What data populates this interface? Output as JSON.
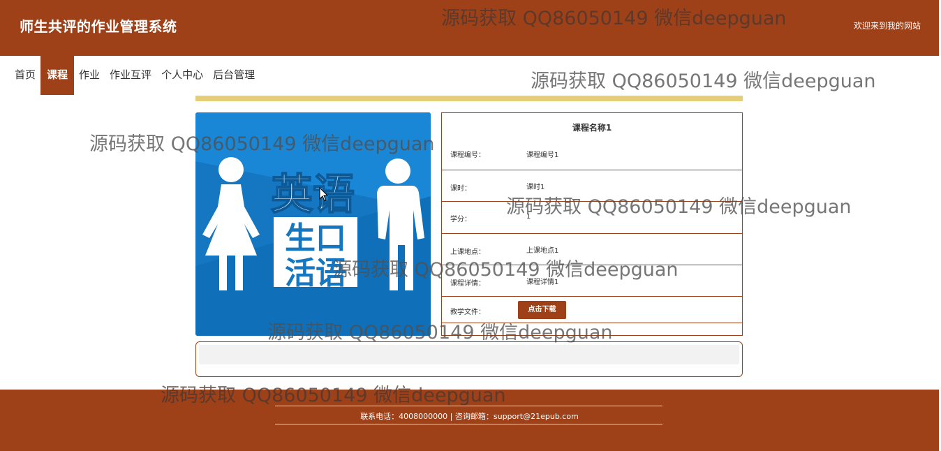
{
  "header": {
    "title": "师生共评的作业管理系统",
    "welcome": "欢迎来到我的网站"
  },
  "nav": {
    "items": [
      {
        "label": "首页"
      },
      {
        "label": "课程",
        "active": true
      },
      {
        "label": "作业"
      },
      {
        "label": "作业互评"
      },
      {
        "label": "个人中心"
      },
      {
        "label": "后台管理"
      }
    ]
  },
  "course": {
    "image_text": [
      "英语",
      "生口",
      "活语"
    ],
    "name": "课程名称1",
    "fields": [
      {
        "label": "课程编号：",
        "value": "课程编号1"
      },
      {
        "label": "课时：",
        "value": "课时1"
      },
      {
        "label": "学分：",
        "value": "1"
      },
      {
        "label": "上课地点：",
        "value": "上课地点1"
      },
      {
        "label": "课程详情：",
        "value": "课程详情1"
      }
    ],
    "file_label": "教学文件：",
    "download_label": "点击下载"
  },
  "footer": {
    "contact": "联系电话：4008000000 | 咨询邮箱：support@21epub.com"
  },
  "watermark": "源码获取 QQ86050149 微信deepguan",
  "colors": {
    "brand": "#9e4118",
    "accent_bar": "#e6cd78",
    "image_bg": "#1577c2"
  }
}
